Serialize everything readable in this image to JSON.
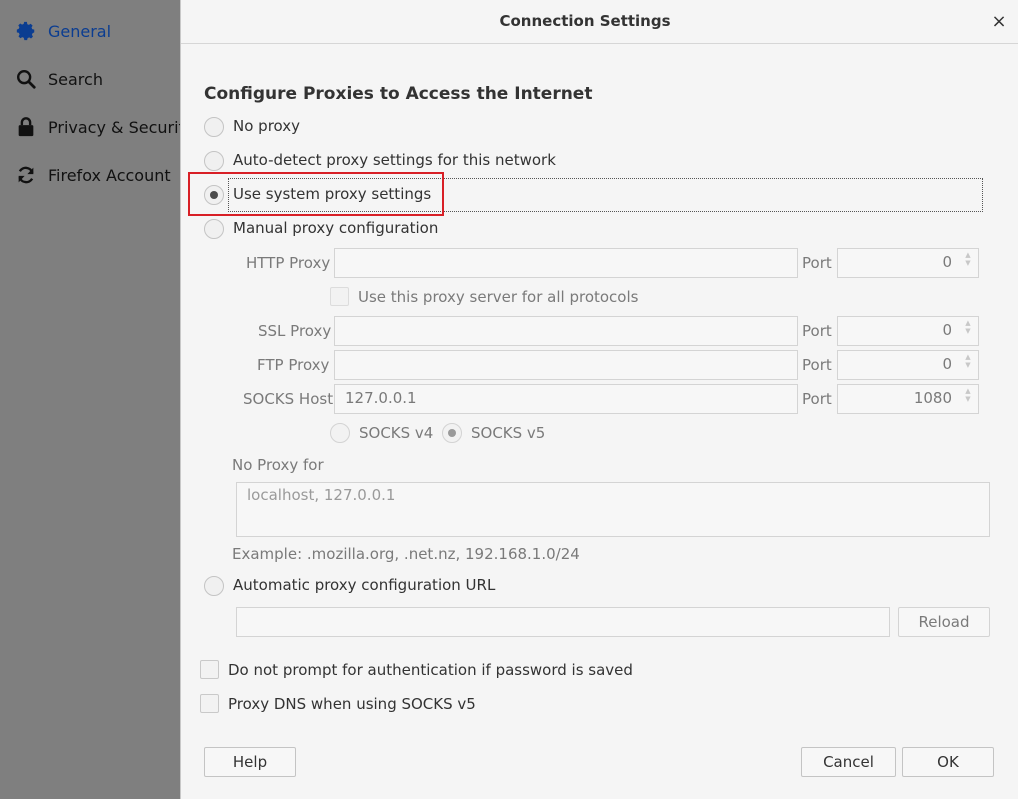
{
  "sidebar": {
    "items": [
      {
        "label": "General",
        "icon": "gear-icon"
      },
      {
        "label": "Search",
        "icon": "search-icon"
      },
      {
        "label": "Privacy & Security",
        "icon": "lock-icon"
      },
      {
        "label": "Firefox Account",
        "icon": "sync-icon"
      }
    ]
  },
  "dialog": {
    "title": "Connection Settings",
    "heading": "Configure Proxies to Access the Internet",
    "options": {
      "no_proxy": "No proxy",
      "auto_detect": "Auto-detect proxy settings for this network",
      "system": "Use system proxy settings",
      "manual": "Manual proxy configuration",
      "auto_url": "Automatic proxy configuration URL"
    },
    "selected_option": "system",
    "manual": {
      "http_label": "HTTP Proxy",
      "http_value": "",
      "http_port": "0",
      "use_all_label": "Use this proxy server for all protocols",
      "ssl_label": "SSL Proxy",
      "ssl_value": "",
      "ssl_port": "0",
      "ftp_label": "FTP Proxy",
      "ftp_value": "",
      "ftp_port": "0",
      "socks_label": "SOCKS Host",
      "socks_value": "127.0.0.1",
      "socks_port": "1080",
      "port_label": "Port",
      "socks_v4": "SOCKS v4",
      "socks_v5": "SOCKS v5"
    },
    "no_proxy_for": {
      "label": "No Proxy for",
      "value": "localhost, 127.0.0.1",
      "example": "Example: .mozilla.org, .net.nz, 192.168.1.0/24"
    },
    "auto_url": {
      "value": "",
      "reload_label": "Reload"
    },
    "checkboxes": {
      "no_prompt": "Do not prompt for authentication if password is saved",
      "proxy_dns": "Proxy DNS when using SOCKS v5"
    },
    "buttons": {
      "help": "Help",
      "cancel": "Cancel",
      "ok": "OK"
    },
    "close_glyph": "×"
  },
  "colors": {
    "sidebar_active": "#0b3d91",
    "highlight": "#d81f26",
    "dialog_bg": "#f5f5f5",
    "overlay_bg": "#7e7e7e"
  }
}
